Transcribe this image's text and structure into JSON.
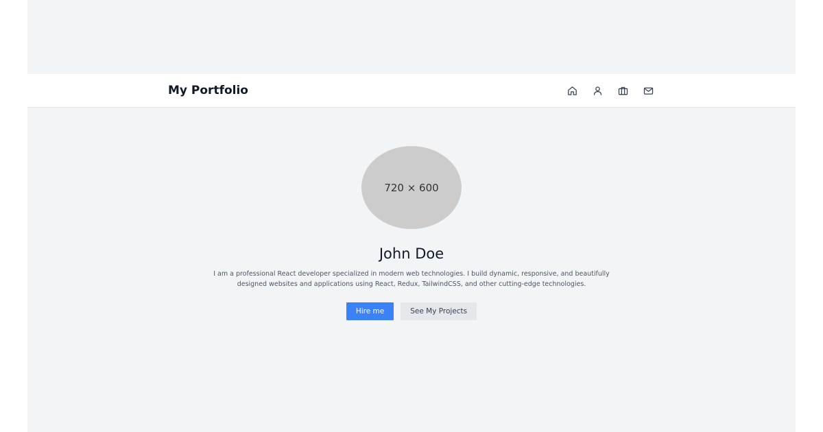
{
  "navbar": {
    "brand": "My Portfolio",
    "icons": [
      "home-icon",
      "user-icon",
      "briefcase-icon",
      "mail-icon"
    ]
  },
  "hero": {
    "avatar_placeholder": "720 × 600",
    "name": "John Doe",
    "bio": "I am a professional React developer specialized in modern web technologies. I build dynamic, responsive, and beautifully designed websites and applications using React, Redux, TailwindCSS, and other cutting-edge technologies.",
    "primary_button": "Hire me",
    "secondary_button": "See My Projects"
  },
  "colors": {
    "background": "#f3f4f6",
    "navbar": "#ffffff",
    "primary": "#3b82f6",
    "secondary": "#e5e7eb",
    "avatar": "#cccccc"
  }
}
